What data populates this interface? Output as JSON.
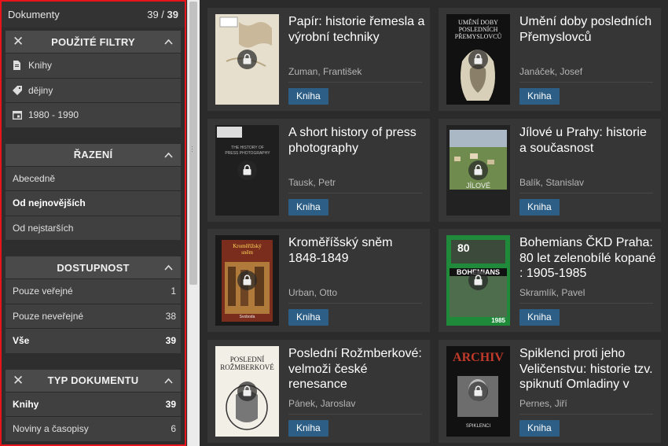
{
  "sidebar": {
    "header": {
      "title": "Dokumenty",
      "count_shown": "39",
      "count_sep": " / ",
      "count_total": "39"
    },
    "filters": {
      "title": "POUŽITÉ FILTRY",
      "items": [
        {
          "icon": "book-icon",
          "label": "Knihy"
        },
        {
          "icon": "tag-icon",
          "label": "dějiny"
        },
        {
          "icon": "calendar-icon",
          "label": "1980 - 1990"
        }
      ]
    },
    "sorting": {
      "title": "ŘAZENÍ",
      "items": [
        {
          "label": "Abecedně",
          "selected": false
        },
        {
          "label": "Od nejnovějších",
          "selected": true
        },
        {
          "label": "Od nejstarších",
          "selected": false
        }
      ]
    },
    "availability": {
      "title": "DOSTUPNOST",
      "items": [
        {
          "label": "Pouze veřejné",
          "count": "1",
          "selected": false
        },
        {
          "label": "Pouze neveřejné",
          "count": "38",
          "selected": false
        },
        {
          "label": "Vše",
          "count": "39",
          "selected": true
        }
      ]
    },
    "doctype": {
      "title": "TYP DOKUMENTU",
      "items": [
        {
          "label": "Knihy",
          "count": "39",
          "selected": true
        },
        {
          "label": "Noviny a časopisy",
          "count": "6",
          "selected": false
        }
      ]
    }
  },
  "documents": [
    {
      "title": "Papír: historie řemesla a výrobní techniky",
      "author": "Zuman, František",
      "type": "Kniha"
    },
    {
      "title": "Umění doby posledních Přemyslovců",
      "author": "Janáček, Josef",
      "type": "Kniha"
    },
    {
      "title": "A short history of press photography",
      "author": "Tausk, Petr",
      "type": "Kniha"
    },
    {
      "title": "Jílové u Prahy: historie a současnost",
      "author": "Balík, Stanislav",
      "type": "Kniha"
    },
    {
      "title": "Kroměříšský sněm 1848-1849",
      "author": "Urban, Otto",
      "type": "Kniha"
    },
    {
      "title": "Bohemians ČKD Praha: 80 let zelenobílé kopané : 1905-1985",
      "author": "Skramlík, Pavel",
      "type": "Kniha"
    },
    {
      "title": "Poslední Rožmberkové: velmoži české renesance",
      "author": "Pánek, Jaroslav",
      "type": "Kniha"
    },
    {
      "title": "Spiklenci proti jeho Veličenstvu: historie tzv. spiknutí Omladiny v",
      "author": "Pernes, Jiří",
      "type": "Kniha"
    }
  ],
  "covers": {
    "0": {
      "title_line1": "",
      "title_line2": ""
    },
    "1": {
      "title_line1": "UMĚNÍ DOBY",
      "title_line2": "POSLEDNÍCH",
      "title_line3": "PŘEMYSLOVCŮ"
    },
    "2": {
      "title_line1": "THE HISTORY OF",
      "title_line2": "PRESS PHOTOGRAPHY"
    },
    "3": {
      "title_line1": "JÍLOVÉ"
    },
    "4": {
      "title_line1": "Kroměřížský",
      "title_line2": "sněm",
      "title_line3": "Svoboda"
    },
    "5": {
      "title_line1": "80",
      "title_line2": "BOHEMIANS",
      "title_line3": "1985"
    },
    "6": {
      "title_line1": "POSLEDNÍ",
      "title_line2": "ROŽMBERKOVÉ"
    },
    "7": {
      "title_line1": "ARCHIV",
      "title_line2": "SPIKLENCI"
    }
  }
}
